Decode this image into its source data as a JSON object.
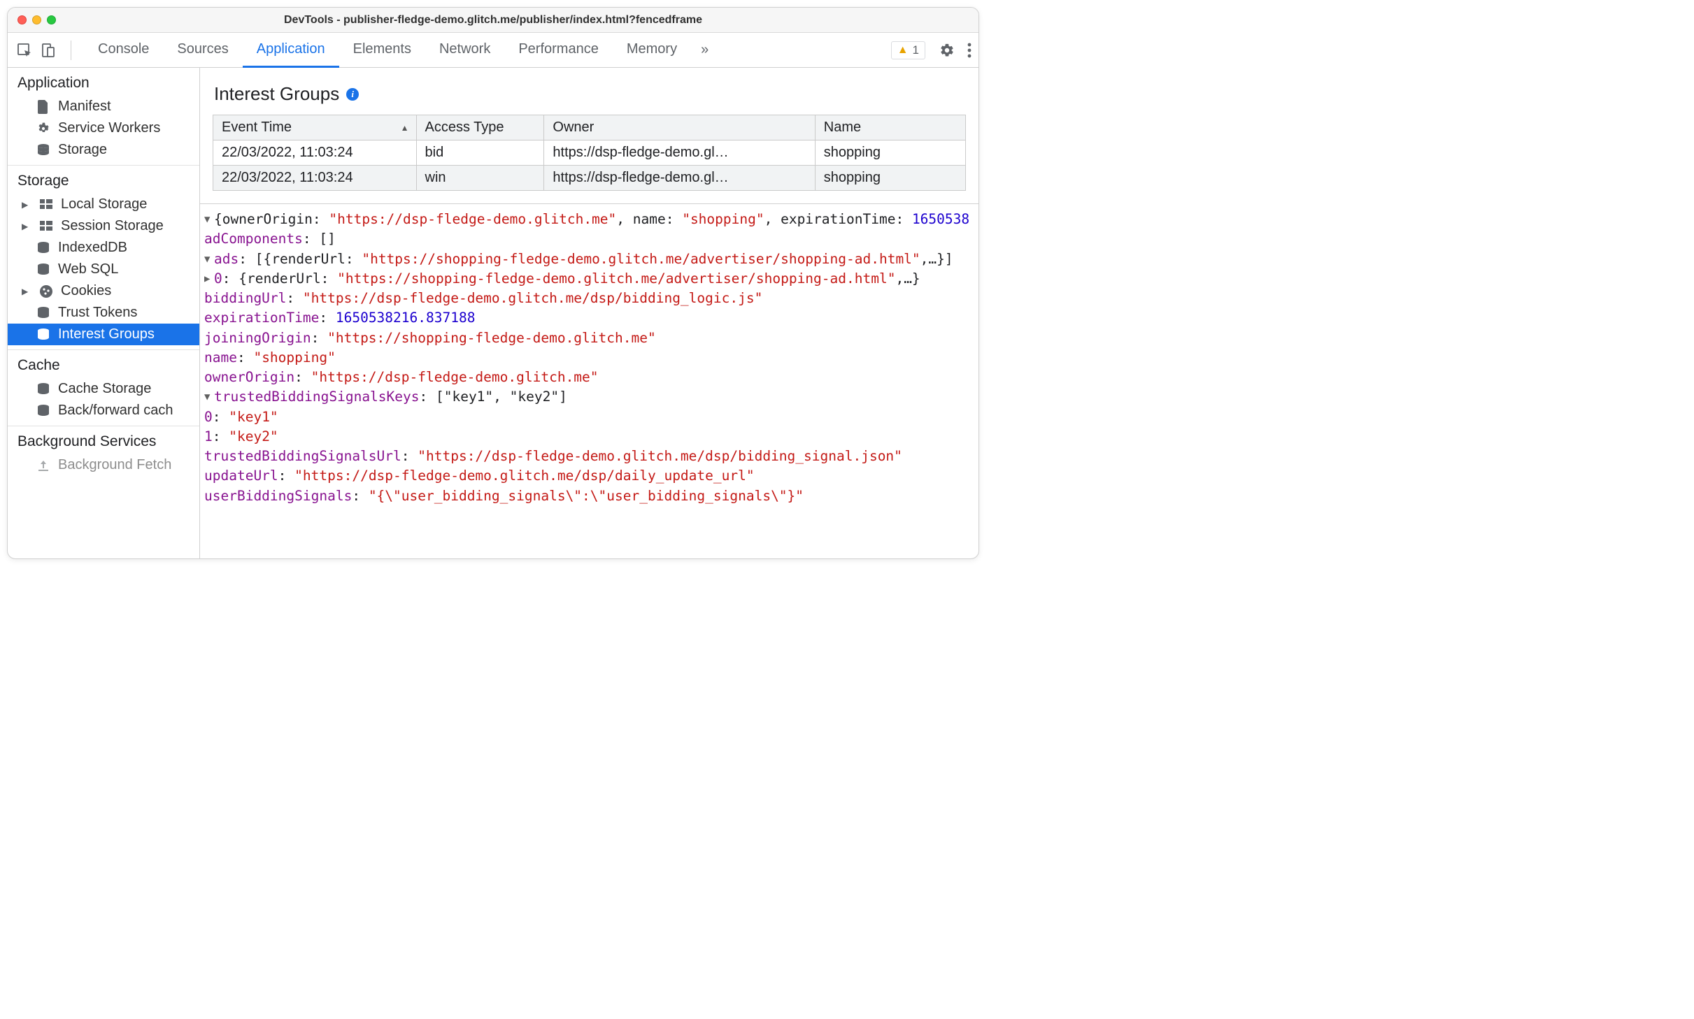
{
  "window": {
    "title": "DevTools - publisher-fledge-demo.glitch.me/publisher/index.html?fencedframe"
  },
  "tabs": {
    "items": [
      "Console",
      "Sources",
      "Application",
      "Elements",
      "Network",
      "Performance",
      "Memory"
    ],
    "active": "Application",
    "more": "»",
    "warning_count": "1"
  },
  "sidebar": {
    "application": {
      "title": "Application",
      "items": [
        {
          "label": "Manifest",
          "icon": "document"
        },
        {
          "label": "Service Workers",
          "icon": "gear"
        },
        {
          "label": "Storage",
          "icon": "db"
        }
      ]
    },
    "storage": {
      "title": "Storage",
      "items": [
        {
          "label": "Local Storage",
          "icon": "grid",
          "arrow": true
        },
        {
          "label": "Session Storage",
          "icon": "grid",
          "arrow": true
        },
        {
          "label": "IndexedDB",
          "icon": "db"
        },
        {
          "label": "Web SQL",
          "icon": "db"
        },
        {
          "label": "Cookies",
          "icon": "cookie",
          "arrow": true
        },
        {
          "label": "Trust Tokens",
          "icon": "db"
        },
        {
          "label": "Interest Groups",
          "icon": "db",
          "selected": true
        }
      ]
    },
    "cache": {
      "title": "Cache",
      "items": [
        {
          "label": "Cache Storage",
          "icon": "db"
        },
        {
          "label": "Back/forward cach",
          "icon": "db"
        }
      ]
    },
    "background": {
      "title": "Background Services",
      "items": [
        {
          "label": "Background Fetch",
          "icon": "upload"
        }
      ]
    }
  },
  "panel": {
    "heading": "Interest Groups",
    "columns": [
      "Event Time",
      "Access Type",
      "Owner",
      "Name"
    ],
    "rows": [
      {
        "time": "22/03/2022, 11:03:24",
        "access": "bid",
        "owner": "https://dsp-fledge-demo.gl…",
        "name": "shopping"
      },
      {
        "time": "22/03/2022, 11:03:24",
        "access": "win",
        "owner": "https://dsp-fledge-demo.gl…",
        "name": "shopping"
      }
    ]
  },
  "detail": {
    "summary_prefix": "{ownerOrigin: ",
    "summary_owner": "\"https://dsp-fledge-demo.glitch.me\"",
    "summary_mid": ", name: ",
    "summary_name": "\"shopping\"",
    "summary_mid2": ", expirationTime: ",
    "summary_exp": "1650538",
    "adComponents_label": "adComponents",
    "adComponents_value": "[]",
    "ads_label": "ads",
    "ads_value_prefix": "[{renderUrl: ",
    "ads_render_url": "\"https://shopping-fledge-demo.glitch.me/advertiser/shopping-ad.html\"",
    "ads_value_suffix": ",…}]",
    "ads_0_label": "0",
    "ads_0_prefix": "{renderUrl: ",
    "ads_0_url": "\"https://shopping-fledge-demo.glitch.me/advertiser/shopping-ad.html\"",
    "ads_0_suffix": ",…}",
    "biddingUrl_label": "biddingUrl",
    "biddingUrl_value": "\"https://dsp-fledge-demo.glitch.me/dsp/bidding_logic.js\"",
    "expirationTime_label": "expirationTime",
    "expirationTime_value": "1650538216.837188",
    "joiningOrigin_label": "joiningOrigin",
    "joiningOrigin_value": "\"https://shopping-fledge-demo.glitch.me\"",
    "name_label": "name",
    "name_value": "\"shopping\"",
    "ownerOrigin_label": "ownerOrigin",
    "ownerOrigin_value": "\"https://dsp-fledge-demo.glitch.me\"",
    "tbsk_label": "trustedBiddingSignalsKeys",
    "tbsk_value": "[\"key1\", \"key2\"]",
    "tbsk_0_label": "0",
    "tbsk_0_value": "\"key1\"",
    "tbsk_1_label": "1",
    "tbsk_1_value": "\"key2\"",
    "tbsu_label": "trustedBiddingSignalsUrl",
    "tbsu_value": "\"https://dsp-fledge-demo.glitch.me/dsp/bidding_signal.json\"",
    "updateUrl_label": "updateUrl",
    "updateUrl_value": "\"https://dsp-fledge-demo.glitch.me/dsp/daily_update_url\"",
    "ubs_label": "userBiddingSignals",
    "ubs_value": "\"{\\\"user_bidding_signals\\\":\\\"user_bidding_signals\\\"}\""
  }
}
